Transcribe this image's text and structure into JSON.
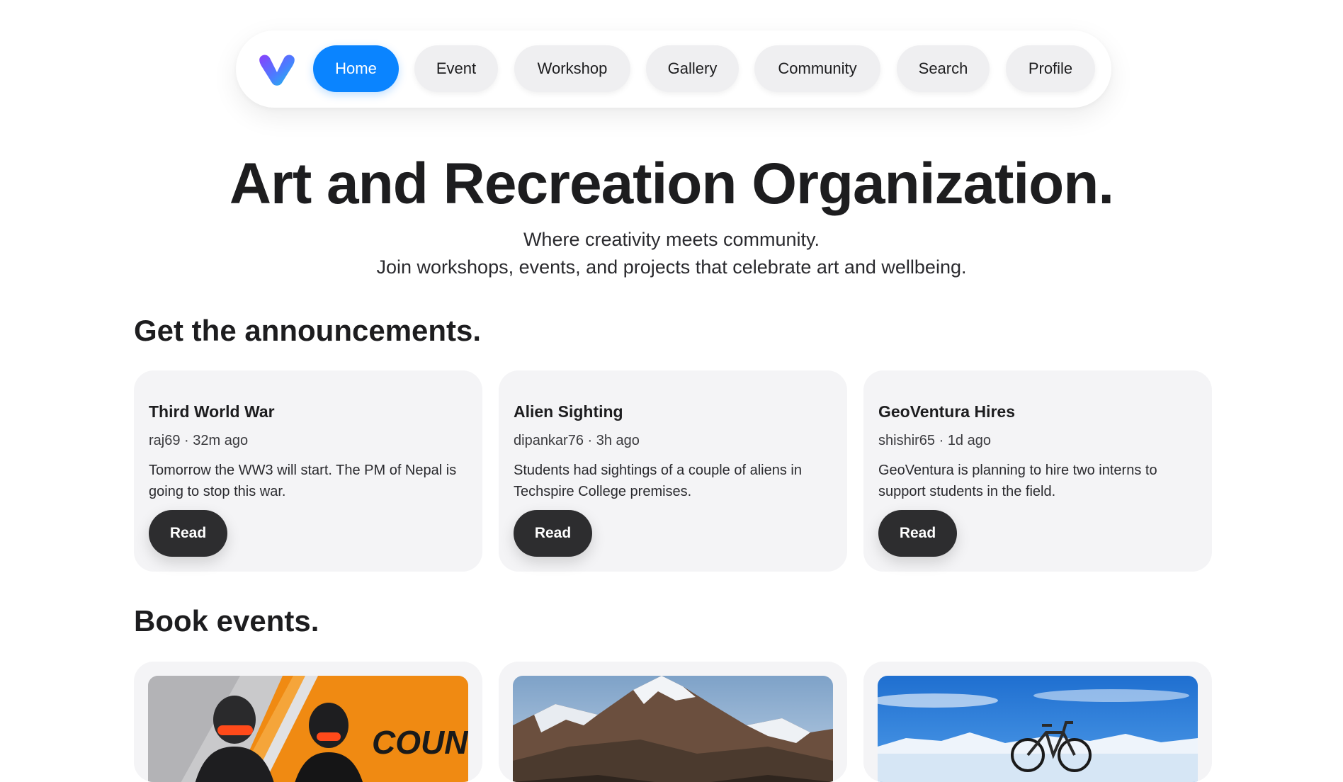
{
  "nav": {
    "logo": "brand-logo-v",
    "items": [
      {
        "label": "Home",
        "active": true
      },
      {
        "label": "Event",
        "active": false
      },
      {
        "label": "Workshop",
        "active": false
      },
      {
        "label": "Gallery",
        "active": false
      },
      {
        "label": "Community",
        "active": false
      },
      {
        "label": "Search",
        "active": false
      },
      {
        "label": "Profile",
        "active": false
      }
    ]
  },
  "hero": {
    "title": "Art and Recreation Organization.",
    "subtitle_line1": "Where creativity meets community.",
    "subtitle_line2": "Join workshops, events, and projects that celebrate art and wellbeing."
  },
  "announcements": {
    "heading": "Get the announcements.",
    "items": [
      {
        "title": "Third World War",
        "meta": "raj69 · 32m ago",
        "body": "Tomorrow the WW3 will start. The PM of Nepal is going to stop this war.",
        "button": "Read"
      },
      {
        "title": "Alien Sighting",
        "meta": "dipankar76 · 3h ago",
        "body": "Students had sightings of a couple of aliens in Techspire College premises.",
        "button": "Read"
      },
      {
        "title": "GeoVentura Hires",
        "meta": "shishir65 · 1d ago",
        "body": "GeoVentura is planning to hire two interns to support students in the field.",
        "button": "Read"
      }
    ]
  },
  "events": {
    "heading": "Book events.",
    "items": [
      {
        "image": "counter-strike-banner",
        "image_text": "COUN"
      },
      {
        "image": "snowy-mountain-photo"
      },
      {
        "image": "bicycle-mountain-photo"
      }
    ]
  },
  "colors": {
    "accent": "#0a84ff",
    "dark_button": "#2d2d2f",
    "card_bg": "#f4f4f6",
    "nav_pill": "#efeff1"
  }
}
